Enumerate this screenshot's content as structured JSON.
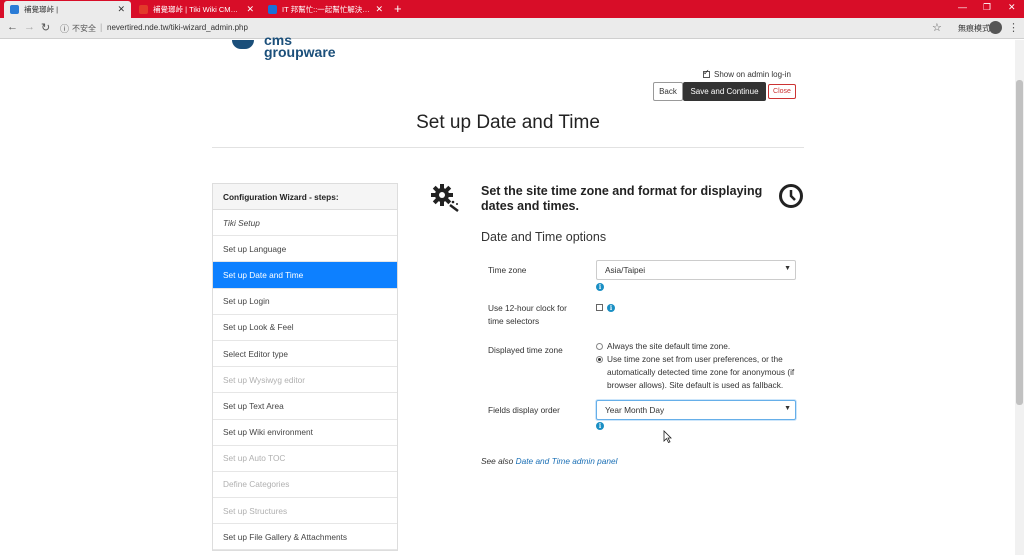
{
  "browser": {
    "tabs": [
      {
        "title": "補覺瑯峠 |",
        "active": true,
        "favicon_color": "#2a7bd6"
      },
      {
        "title": "補覺瑯峠 | Tiki Wiki CMS Groupware",
        "active": false,
        "favicon_color": "#2a7bd6"
      },
      {
        "title": "IT 邦幫忙::一起幫忙解決難題，拯救 IT 人的一天",
        "active": false,
        "favicon_color": "#1a6fd8"
      }
    ],
    "new_tab": "+",
    "security_label": "不安全",
    "url": "nevertired.nde.tw/tiki-wizard_admin.php",
    "incognito_label": "無痕模式"
  },
  "header": {
    "logo_line1": "cms",
    "logo_line2": "groupware",
    "show_on_admin": "Show on admin log-in",
    "back_label": "Back",
    "save_label": "Save and Continue",
    "close_label": "Close",
    "page_title": "Set up Date and Time"
  },
  "sidebar": {
    "header": "Configuration Wizard - steps:",
    "items": [
      {
        "label": "Tiki Setup",
        "state": "italic"
      },
      {
        "label": "Set up Language",
        "state": "normal"
      },
      {
        "label": "Set up Date and Time",
        "state": "active"
      },
      {
        "label": "Set up Login",
        "state": "normal"
      },
      {
        "label": "Set up Look & Feel",
        "state": "normal"
      },
      {
        "label": "Select Editor type",
        "state": "normal"
      },
      {
        "label": "Set up Wysiwyg editor",
        "state": "disabled"
      },
      {
        "label": "Set up Text Area",
        "state": "normal"
      },
      {
        "label": "Set up Wiki environment",
        "state": "normal"
      },
      {
        "label": "Set up Auto TOC",
        "state": "disabled"
      },
      {
        "label": "Define Categories",
        "state": "disabled"
      },
      {
        "label": "Set up Structures",
        "state": "disabled"
      },
      {
        "label": "Set up File Gallery & Attachments",
        "state": "normal"
      }
    ]
  },
  "main": {
    "heading": "Set the site time zone and format for displaying dates and times.",
    "section_title": "Date and Time options",
    "timezone_label": "Time zone",
    "timezone_value": "Asia/Taipei",
    "clock12_label": "Use 12-hour clock for time selectors",
    "clock12_checked": false,
    "displayed_tz_label": "Displayed time zone",
    "radio_option1": "Always the site default time zone.",
    "radio_option2": "Use time zone set from user preferences, or the automatically detected time zone for anonymous (if browser allows). Site default is used as fallback.",
    "radio_selected": 2,
    "fields_order_label": "Fields display order",
    "fields_order_value": "Year Month Day",
    "see_also_prefix": "See also",
    "see_also_link": "Date and Time admin panel"
  },
  "colors": {
    "chrome_red": "#d80d28",
    "active_step": "#0d80ff",
    "info_icon": "#1a8fc4",
    "link": "#1a6fb5"
  }
}
